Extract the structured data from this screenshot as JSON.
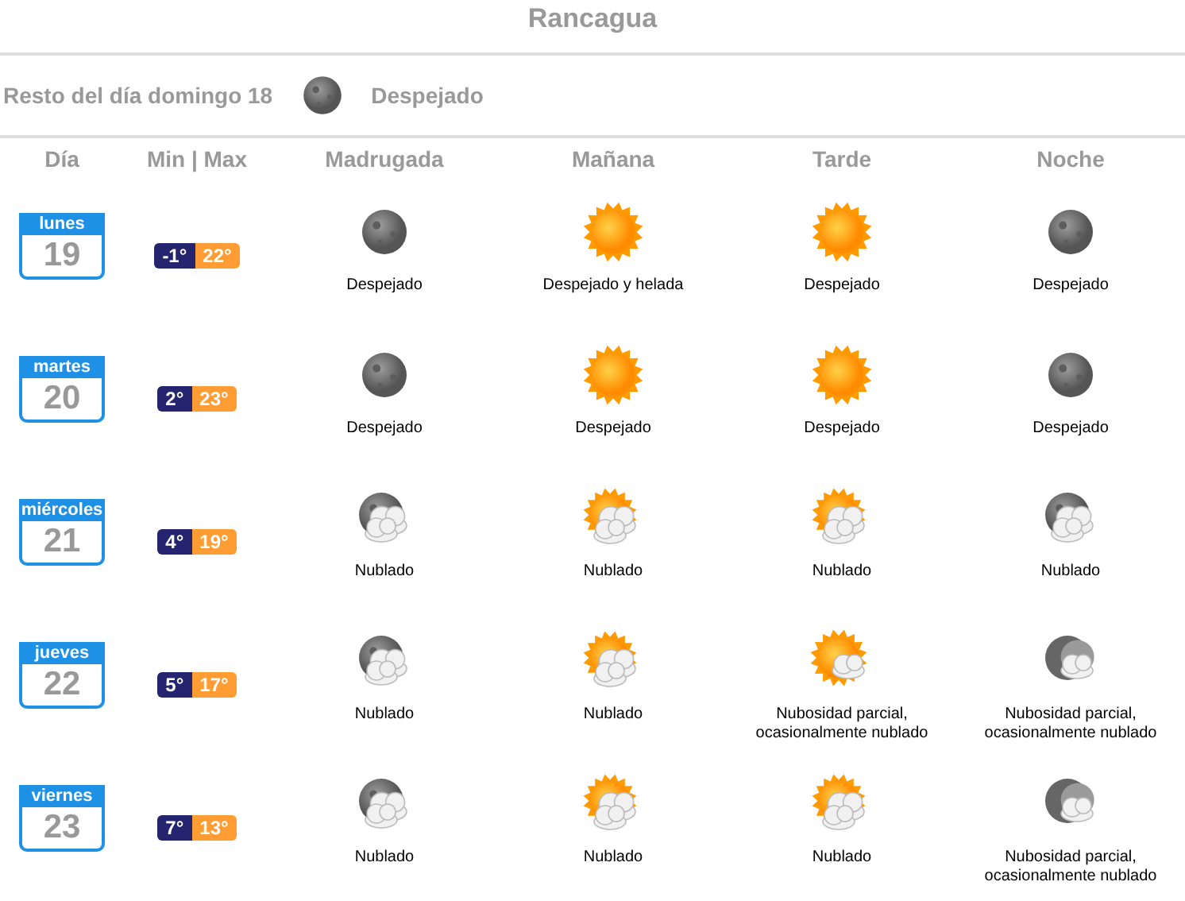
{
  "title": "Rancagua",
  "today": {
    "label": "Resto del día domingo 18",
    "kind": "moon",
    "condition": "Despejado"
  },
  "columns": [
    "Día",
    "Min | Max",
    "Madrugada",
    "Mañana",
    "Tarde",
    "Noche"
  ],
  "days": [
    {
      "weekday": "lunes",
      "date": "19",
      "min": "-1°",
      "max": "22°",
      "periods": [
        {
          "kind": "moon",
          "text": "Despejado"
        },
        {
          "kind": "sun",
          "text": "Despejado y helada"
        },
        {
          "kind": "sun",
          "text": "Despejado"
        },
        {
          "kind": "moon",
          "text": "Despejado"
        }
      ]
    },
    {
      "weekday": "martes",
      "date": "20",
      "min": "2°",
      "max": "23°",
      "periods": [
        {
          "kind": "moon",
          "text": "Despejado"
        },
        {
          "kind": "sun",
          "text": "Despejado"
        },
        {
          "kind": "sun",
          "text": "Despejado"
        },
        {
          "kind": "moon",
          "text": "Despejado"
        }
      ]
    },
    {
      "weekday": "miércoles",
      "date": "21",
      "min": "4°",
      "max": "19°",
      "periods": [
        {
          "kind": "mooncloudy",
          "text": "Nublado"
        },
        {
          "kind": "suncloudy",
          "text": "Nublado"
        },
        {
          "kind": "suncloudy",
          "text": "Nublado"
        },
        {
          "kind": "mooncloudy",
          "text": "Nublado"
        }
      ]
    },
    {
      "weekday": "jueves",
      "date": "22",
      "min": "5°",
      "max": "17°",
      "periods": [
        {
          "kind": "mooncloudy",
          "text": "Nublado"
        },
        {
          "kind": "suncloudy",
          "text": "Nublado"
        },
        {
          "kind": "sunpartly",
          "text": "Nubosidad parcial, ocasionalmente nublado"
        },
        {
          "kind": "moonpartly",
          "text": "Nubosidad parcial, ocasionalmente nublado"
        }
      ]
    },
    {
      "weekday": "viernes",
      "date": "23",
      "min": "7°",
      "max": "13°",
      "periods": [
        {
          "kind": "mooncloudy",
          "text": "Nublado"
        },
        {
          "kind": "suncloudy",
          "text": "Nublado"
        },
        {
          "kind": "suncloudy",
          "text": "Nublado"
        },
        {
          "kind": "moonpartly",
          "text": "Nubosidad parcial, ocasionalmente nublado"
        }
      ]
    }
  ]
}
